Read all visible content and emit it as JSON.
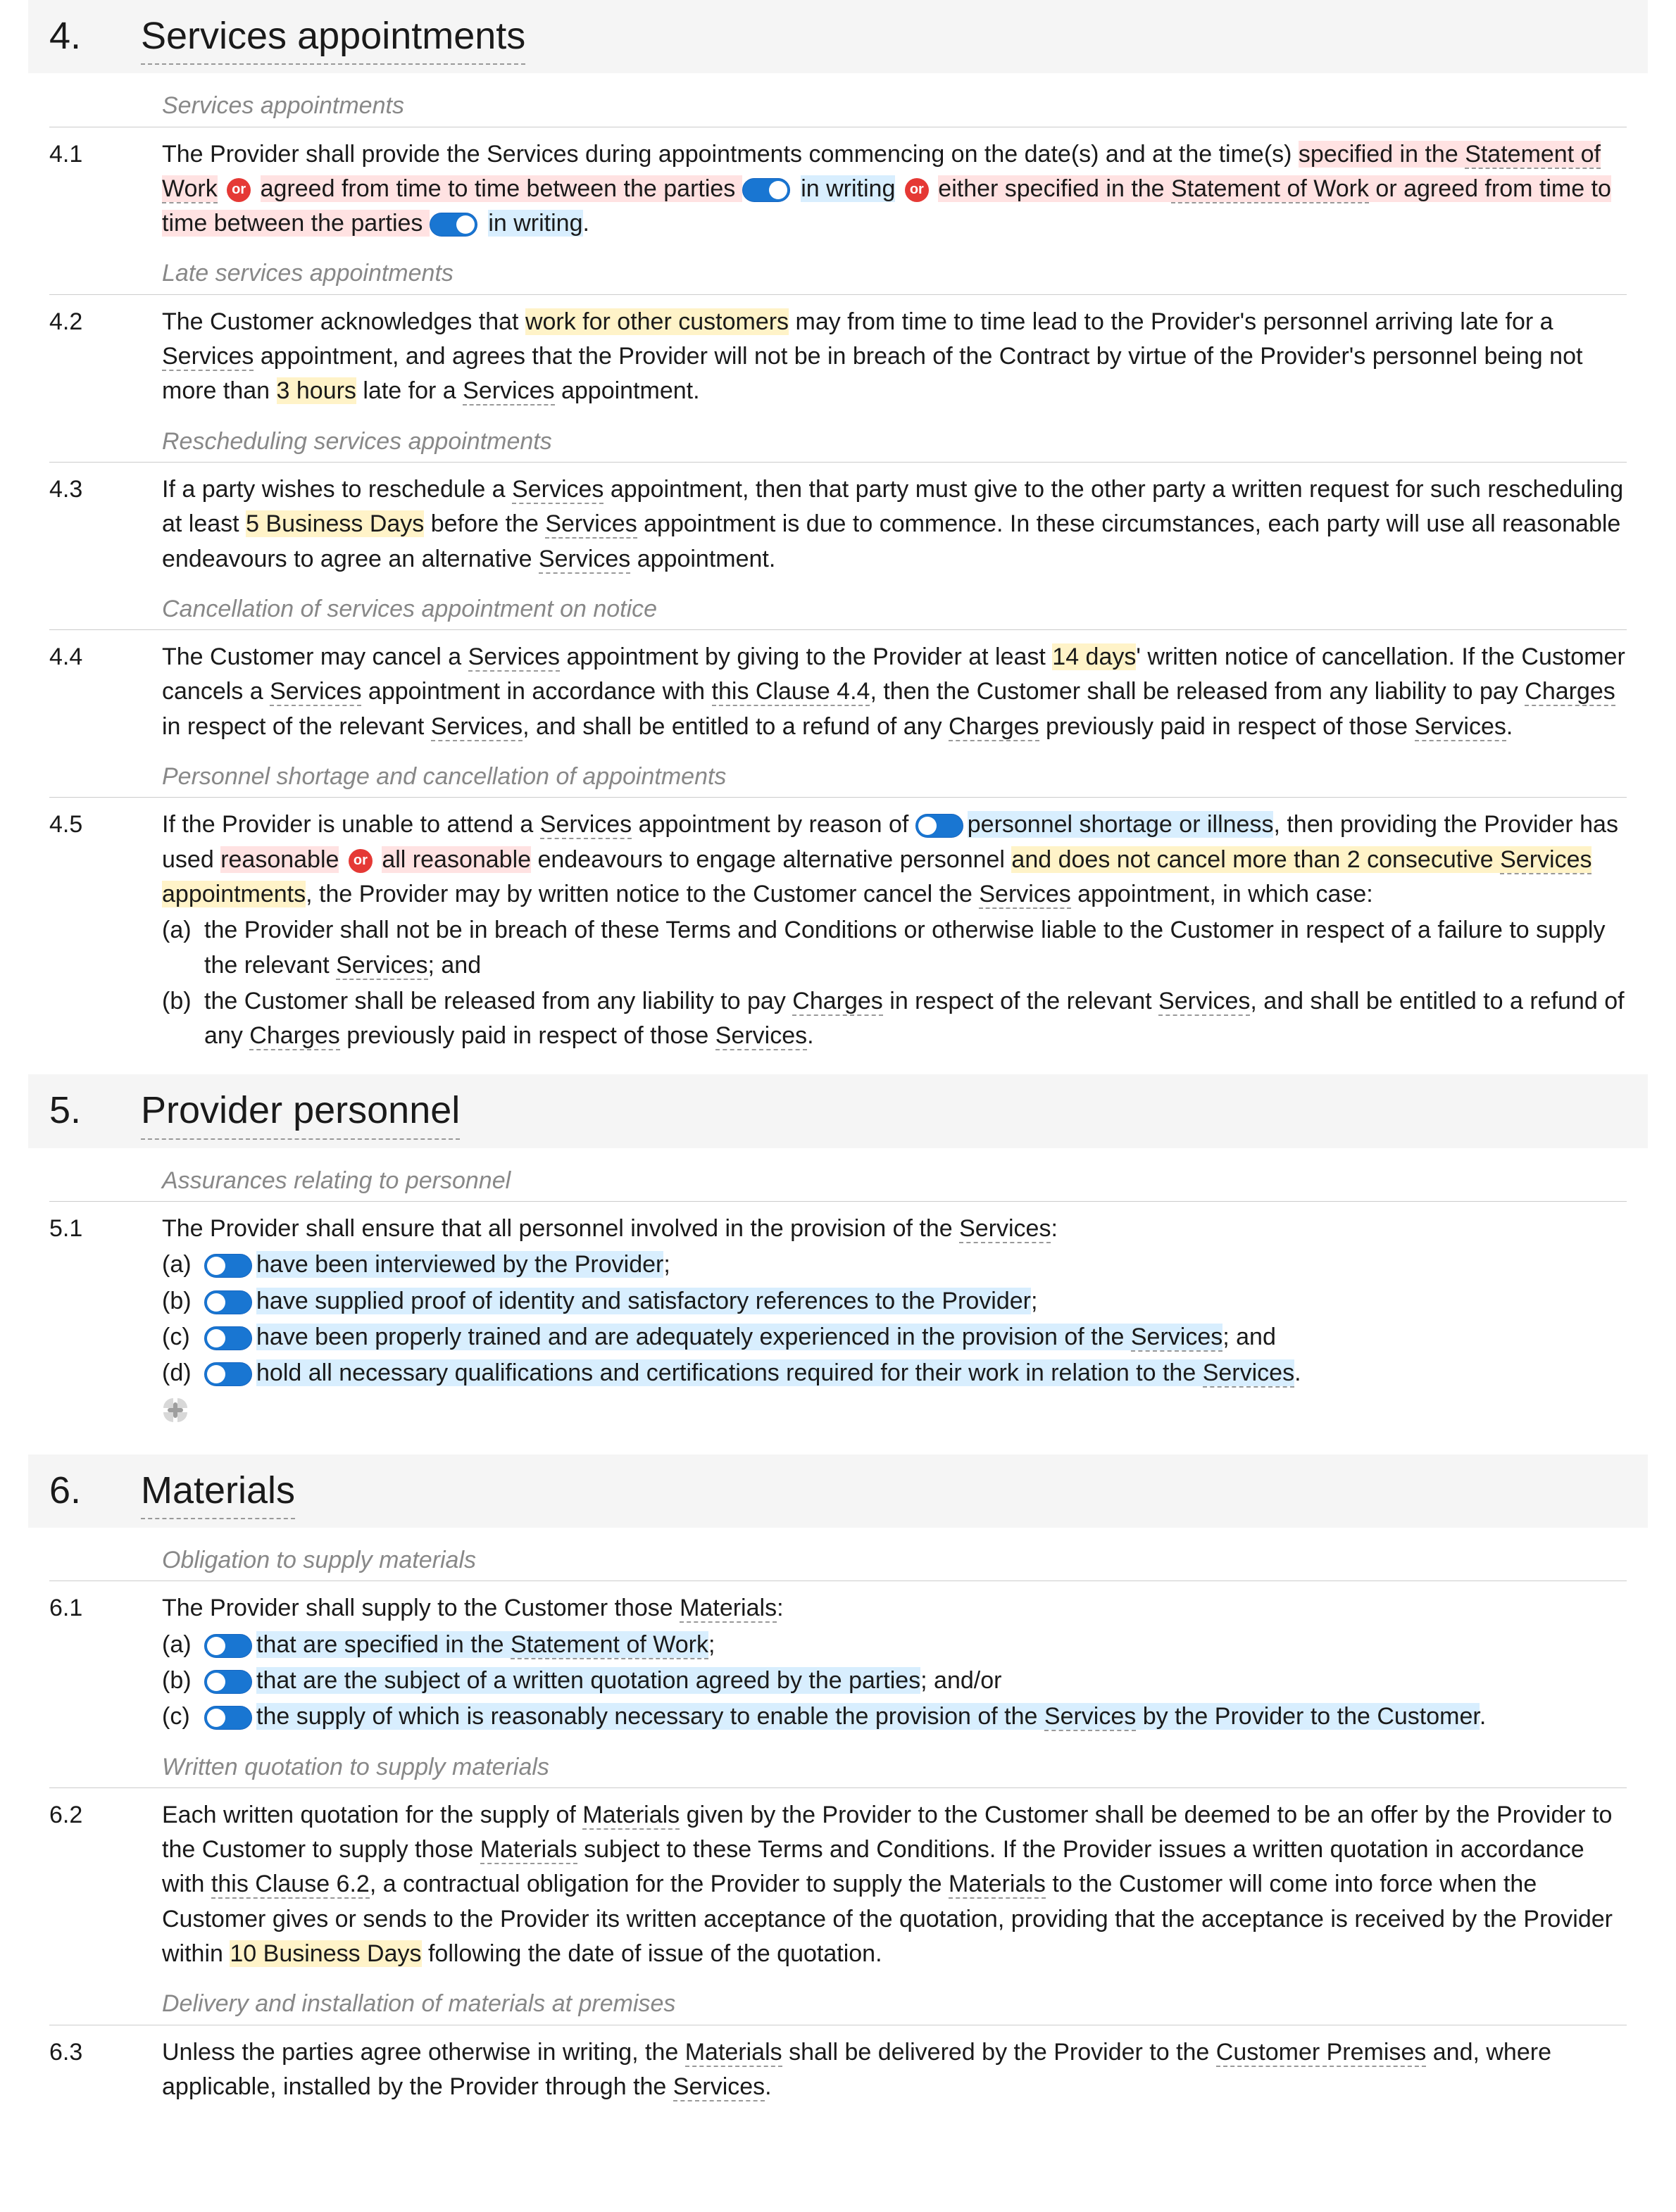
{
  "badges": {
    "or": "or"
  },
  "s4": {
    "num": "4.",
    "title": "Services appointments",
    "sub1": "Services appointments",
    "c41_num": "4.1",
    "c41_a": "The Provider shall provide the Services during appointments commencing on the date(s) and at the time(s) ",
    "c41_b": "specified in the ",
    "c41_sow1": "Statement of Work",
    "c41_c": " agreed from time to time between the parties ",
    "c41_d": "in writing",
    "c41_e": " either specified in the ",
    "c41_sow2": "Statement of Work",
    "c41_f": " or agreed from time to time between the parties ",
    "c41_g": "in writing",
    "c41_end": ".",
    "sub2": "Late services appointments",
    "c42_num": "4.2",
    "c42_a": "The Customer acknowledges that ",
    "c42_hl": "work for other customers",
    "c42_b": " may from time to time lead to the Provider's personnel arriving late for a ",
    "c42_svc1": "Services",
    "c42_c": " appointment, and agrees that the Provider will not be in breach of the Contract by virtue of the Provider's personnel being not more than ",
    "c42_hours": "3 hours",
    "c42_d": " late for a ",
    "c42_svc2": "Services",
    "c42_e": " appointment.",
    "sub3": "Rescheduling services appointments",
    "c43_num": "4.3",
    "c43_a": "If a party wishes to reschedule a ",
    "c43_svc1": "Services",
    "c43_b": " appointment, then that party must give to the other party a written request for such rescheduling at least ",
    "c43_days": "5 Business Days",
    "c43_c": " before the ",
    "c43_svc2": "Services",
    "c43_d": " appointment is due to commence. In these circumstances, each party will use all reasonable endeavours to agree an alternative ",
    "c43_svc3": "Services",
    "c43_e": " appointment.",
    "sub4": "Cancellation of services appointment on notice",
    "c44_num": "4.4",
    "c44_a": "The Customer may cancel a ",
    "c44_svc1": "Services",
    "c44_b": " appointment by giving to the Provider at least ",
    "c44_days": "14 days",
    "c44_c": "' written notice of cancellation. If the Customer cancels a ",
    "c44_svc2": "Services",
    "c44_d": " appointment in accordance with ",
    "c44_this": "this Clause 4.4",
    "c44_e": ", then the Customer shall be released from any liability to pay ",
    "c44_chg1": "Charges",
    "c44_f": " in respect of the relevant ",
    "c44_svc3": "Services",
    "c44_g": ", and shall be entitled to a refund of any ",
    "c44_chg2": "Charges",
    "c44_h": " previously paid in respect of those ",
    "c44_svc4": "Services",
    "c44_i": ".",
    "sub5": "Personnel shortage and cancellation of appointments",
    "c45_num": "4.5",
    "c45_a": "If the Provider is unable to attend a ",
    "c45_svc1": "Services",
    "c45_b": " appointment by reason of ",
    "c45_reason": "personnel shortage or illness",
    "c45_c": ", then providing the Provider has used ",
    "c45_reasonable": "reasonable",
    "c45_allreasonable": "all reasonable",
    "c45_d": " endeavours to engage alternative personnel ",
    "c45_limit": "and does not cancel more than ",
    "c45_count": "2 consecutive",
    "c45_limit2": " ",
    "c45_svc2": "Services",
    "c45_limit3": " appointments",
    "c45_e": ", the Provider may by written notice to the Customer cancel the ",
    "c45_svc3": "Services",
    "c45_f": " appointment, in which case:",
    "c45_sa_l": "(a)",
    "c45_sa_1": "the Provider shall not be in breach of these Terms and Conditions or otherwise liable to the Customer in respect of a failure to supply the relevant ",
    "c45_sa_svc": "Services",
    "c45_sa_2": "; and",
    "c45_sb_l": "(b)",
    "c45_sb_1": "the Customer shall be released from any liability to pay ",
    "c45_sb_chg1": "Charges",
    "c45_sb_2": " in respect of the relevant ",
    "c45_sb_svc1": "Services",
    "c45_sb_3": ", and shall be entitled to a refund of any ",
    "c45_sb_chg2": "Charges",
    "c45_sb_4": " previously paid in respect of those ",
    "c45_sb_svc2": "Services",
    "c45_sb_5": "."
  },
  "s5": {
    "num": "5.",
    "title": "Provider personnel",
    "sub1": "Assurances relating to personnel",
    "c51_num": "5.1",
    "c51_intro_a": "The Provider shall ensure that all personnel involved in the provision of the ",
    "c51_intro_svc": "Services",
    "c51_intro_b": ":",
    "c51_a_l": "(a)",
    "c51_a_t": "have been interviewed by the Provider",
    "c51_a_end": ";",
    "c51_b_l": "(b)",
    "c51_b_t": "have supplied proof of identity and satisfactory references to the Provider",
    "c51_b_end": ";",
    "c51_c_l": "(c)",
    "c51_c_t1": "have been properly trained and are adequately experienced in the provision of the ",
    "c51_c_svc": "Services",
    "c51_c_end": "; and",
    "c51_d_l": "(d)",
    "c51_d_t1": "hold all necessary qualifications and certifications required for their work in relation to the ",
    "c51_d_svc": "Services",
    "c51_d_end": "."
  },
  "s6": {
    "num": "6.",
    "title": "Materials",
    "sub1": "Obligation to supply materials",
    "c61_num": "6.1",
    "c61_intro_a": "The Provider shall supply to the Customer those ",
    "c61_intro_mat": "Materials",
    "c61_intro_b": ":",
    "c61_a_l": "(a)",
    "c61_a_1": "that are specified in the ",
    "c61_a_sow": "Statement of Work",
    "c61_a_end": ";",
    "c61_b_l": "(b)",
    "c61_b_t": "that are the subject of a written quotation agreed by the parties",
    "c61_b_end": "; and/or",
    "c61_c_l": "(c)",
    "c61_c_1": "the supply of which is reasonably necessary to enable the provision of the ",
    "c61_c_svc": "Services",
    "c61_c_2": " by the Provider to the Customer",
    "c61_c_end": ".",
    "sub2": "Written quotation to supply materials",
    "c62_num": "6.2",
    "c62_a": "Each written quotation for the supply of ",
    "c62_mat1": "Materials",
    "c62_b": " given by the Provider to the Customer shall be deemed to be an offer by the Provider to the Customer to supply those ",
    "c62_mat2": "Materials",
    "c62_c": " subject to these Terms and Conditions. If the Provider issues a written quotation in accordance with ",
    "c62_this": "this Clause 6.2",
    "c62_d": ", a contractual obligation for the Provider to supply the ",
    "c62_mat3": "Materials",
    "c62_e": " to the Customer will come into force when the Customer gives or sends to the Provider its written acceptance of the quotation, providing that the acceptance is received by the Provider within ",
    "c62_days": "10 Business Days",
    "c62_f": " following the date of issue of the quotation.",
    "sub3": "Delivery and installation of materials at premises",
    "c63_num": "6.3",
    "c63_a": "Unless the parties agree otherwise in writing, the ",
    "c63_mat": "Materials",
    "c63_b": " shall be delivered by the Provider to the ",
    "c63_prem": "Customer Premises",
    "c63_c": " and, where applicable, installed by the Provider through the ",
    "c63_svc": "Services",
    "c63_d": "."
  }
}
